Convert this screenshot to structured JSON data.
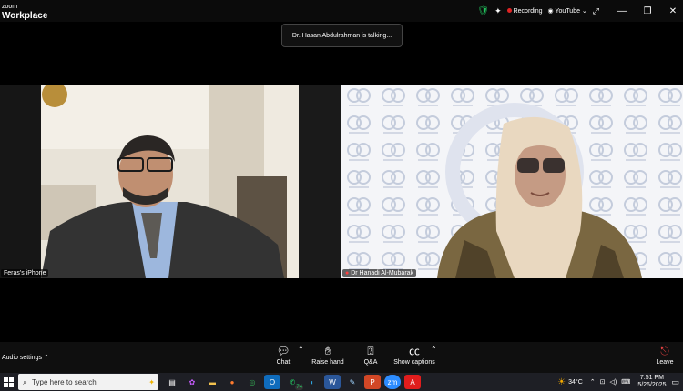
{
  "app": {
    "brand_line1": "zoom",
    "brand_line2": "Workplace"
  },
  "titlebar": {
    "recording_label": "Recording",
    "youtube_label": "YouTube"
  },
  "notice": {
    "talking_text": "Dr. Hasan Abdulrahman is talking..."
  },
  "participants": [
    {
      "name": "Feras's iPhone"
    },
    {
      "name": "Dr Hanadi Al-Mubarak"
    }
  ],
  "toolbar": {
    "audio_settings": "Audio settings",
    "chat": "Chat",
    "raise_hand": "Raise hand",
    "qa": "Q&A",
    "show_captions": "Show captions",
    "leave": "Leave"
  },
  "taskbar": {
    "search_placeholder": "Type here to search",
    "whatsapp_badge": "74",
    "weather": "34°C",
    "time": "7:51 PM",
    "date": "5/26/2025"
  }
}
